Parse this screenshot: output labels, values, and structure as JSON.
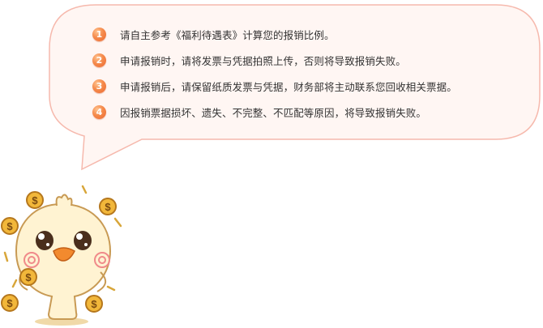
{
  "notices": [
    {
      "num": "1",
      "text": "请自主参考《福利待遇表》计算您的报销比例。"
    },
    {
      "num": "2",
      "text": "申请报销时，请将发票与凭据拍照上传，否则将导致报销失败。"
    },
    {
      "num": "3",
      "text": "申请报销后，请保留纸质发票与凭据，财务部将主动联系您回收相关票据。"
    },
    {
      "num": "4",
      "text": "因报销票据损坏、遗失、不完整、不匹配等原因，将导致报销失败。"
    }
  ],
  "mascot": {
    "coin_symbol": "$",
    "icon": "chick-with-coins-icon"
  },
  "colors": {
    "bubble_fill": "#fff6f3",
    "bubble_border": "#f6b9ad",
    "badge": "#f07a3e",
    "text": "#333333",
    "coin": "#f2b73a"
  }
}
